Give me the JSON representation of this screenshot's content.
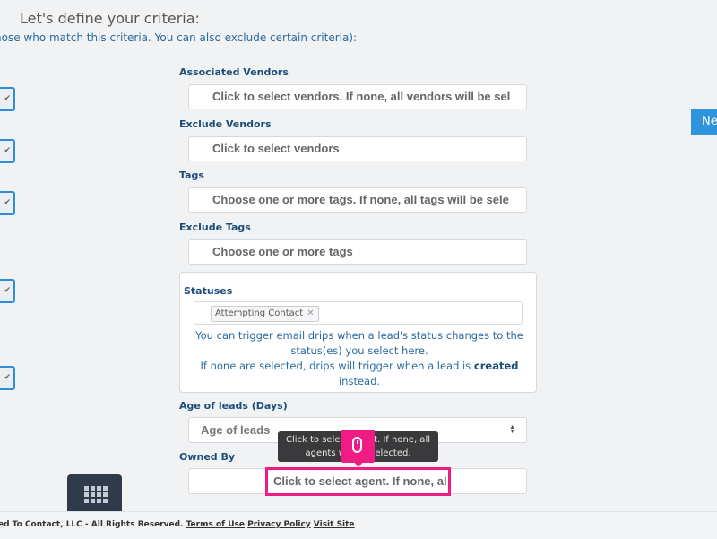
{
  "header": {
    "title": "Let's define your criteria:",
    "subtitle": "hose who match this criteria. You can also exclude certain criteria):"
  },
  "next_button": {
    "label": "Ne"
  },
  "fields": {
    "associated_vendors": {
      "label": "Associated Vendors",
      "placeholder": "Click to select vendors. If none, all vendors will be sel"
    },
    "exclude_vendors": {
      "label": "Exclude Vendors",
      "placeholder": "Click to select vendors"
    },
    "tags": {
      "label": "Tags",
      "placeholder": "Choose one or more tags. If none, all tags will be sele"
    },
    "exclude_tags": {
      "label": "Exclude Tags",
      "placeholder": "Choose one or more tags"
    },
    "statuses": {
      "label": "Statuses",
      "selected": [
        "Attempting Contact"
      ],
      "remove_glyph": "✕",
      "help_line1": "You can trigger email drips when a lead's status changes to the status(es) you select here.",
      "help_line2_prefix": "If none are selected, drips will trigger when a lead is ",
      "help_line2_bold": "created",
      "help_line2_suffix": " instead."
    },
    "age_of_leads": {
      "label": "Age of leads (Days)",
      "placeholder": "Age of leads"
    },
    "owned_by": {
      "label": "Owned By",
      "placeholder": "Click to select agent. If none, al"
    }
  },
  "tooltip": {
    "line1": "Click to select agent. If none, all",
    "line2": "agents will be selected."
  },
  "left_toggles": [
    "check-icon",
    "check-icon",
    "check-icon",
    "check-icon",
    "check-icon"
  ],
  "footer": {
    "copyright": "ed To Contact, LLC - All Rights Reserved.",
    "links": [
      "Terms of Use",
      "Privacy Policy",
      "Visit Site"
    ]
  },
  "colors": {
    "accent": "#2f93dd",
    "highlight": "#f01b83",
    "label": "#1d4d7a",
    "help_text": "#2b6aa0"
  }
}
